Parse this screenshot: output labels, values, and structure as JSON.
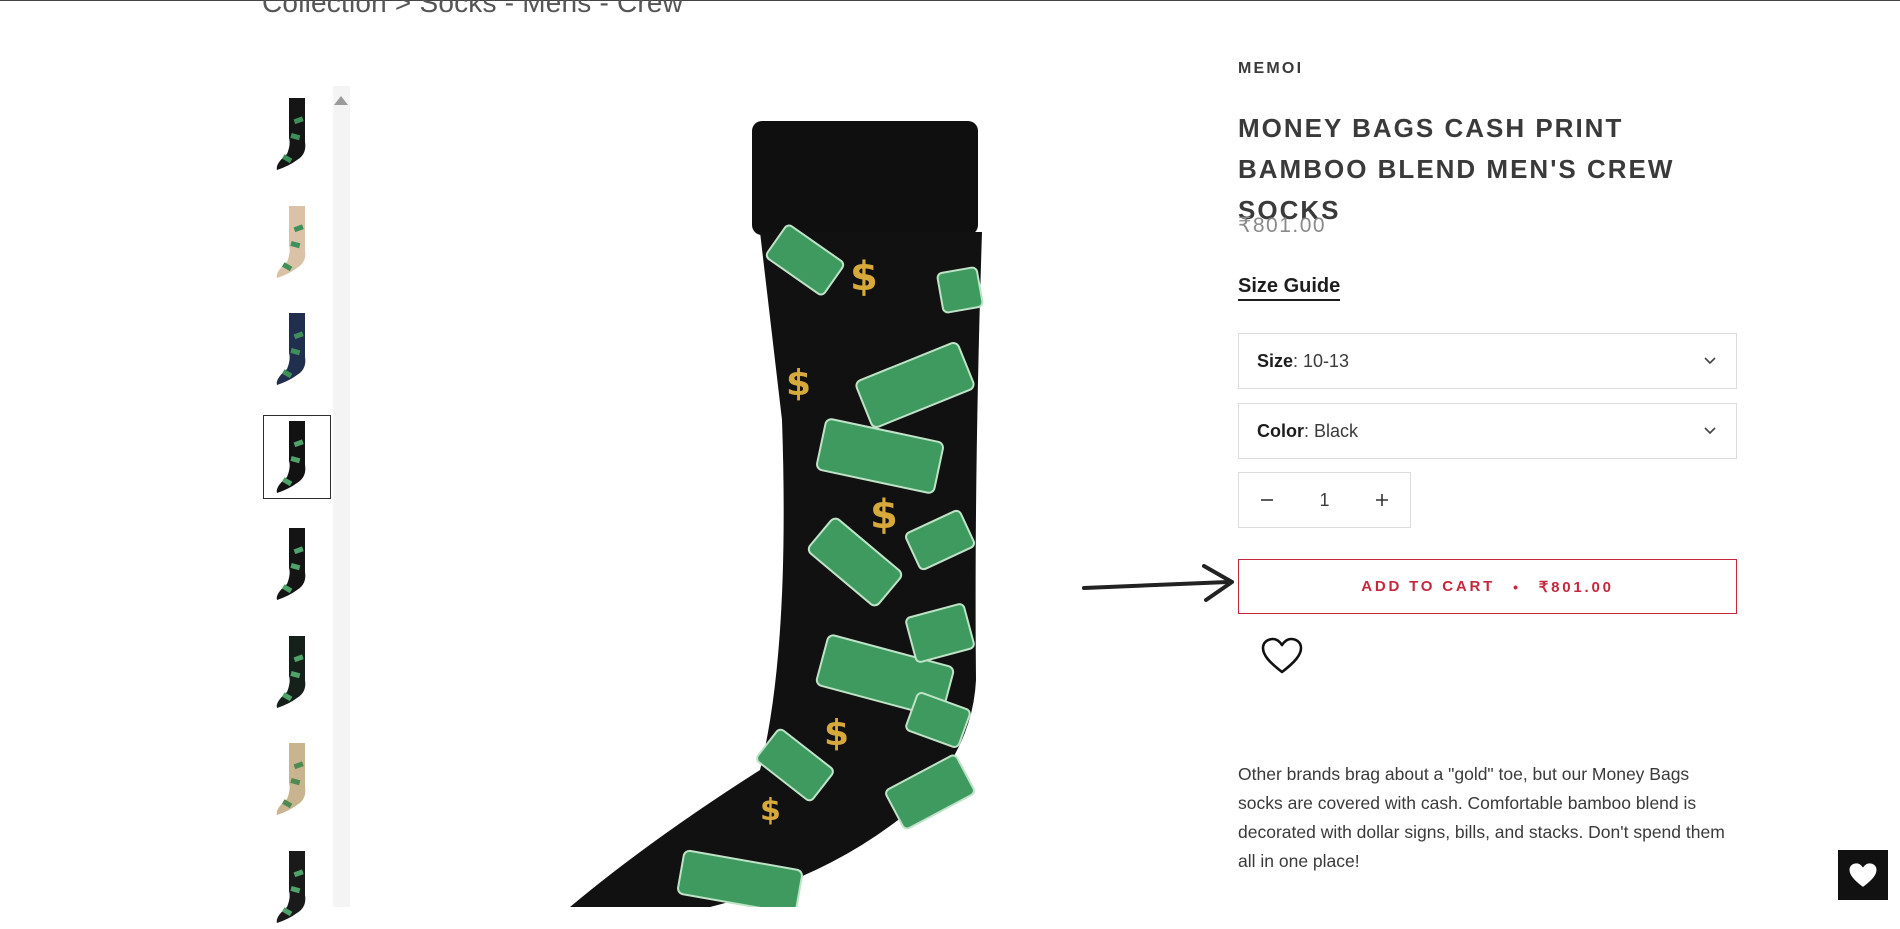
{
  "breadcrumb": "Collection > Socks - Mens - Crew",
  "product": {
    "vendor": "MEMOI",
    "title": "MONEY BAGS CASH PRINT BAMBOO BLEND MEN'S CREW SOCKS",
    "price": "₹801.00",
    "size_guide": "Size Guide",
    "size": {
      "label": "Size",
      "value": ": 10-13"
    },
    "color": {
      "label": "Color",
      "value": ": Black"
    },
    "quantity": "1",
    "add_to_cart": {
      "label": "ADD TO CART",
      "separator": "•",
      "price": "₹801.00"
    },
    "description": "Other brands brag about a \"gold\" toe, but our Money Bags socks are covered with cash. Comfortable bamboo blend is decorated with dollar signs, bills, and stacks. Don't spend them all in one place!"
  },
  "thumbnails": [
    {
      "name": "black-multicolor",
      "base": "#151515",
      "accent": "#3e8f5a",
      "active": false
    },
    {
      "name": "tan-cash",
      "base": "#d9c2a5",
      "accent": "#3e8f5a",
      "active": false
    },
    {
      "name": "navy-cash",
      "base": "#1f2f4d",
      "accent": "#3e8f5a",
      "active": false
    },
    {
      "name": "black-cash",
      "base": "#121212",
      "accent": "#4fa36a",
      "active": true
    },
    {
      "name": "black-pair",
      "base": "#141414",
      "accent": "#4fa36a",
      "active": false
    },
    {
      "name": "black-pair-2",
      "base": "#16201b",
      "accent": "#4fa36a",
      "active": false
    },
    {
      "name": "khaki-cash",
      "base": "#c8b48e",
      "accent": "#4f8a52",
      "active": false
    },
    {
      "name": "black-packaged",
      "base": "#1a1a1a",
      "accent": "#4fa36a",
      "active": false
    }
  ],
  "colors": {
    "accent": "#c5283d",
    "text": "#3a3a3a",
    "price": "#8a8a8a",
    "sock": "#0f0f0f",
    "bill": "#3e9a5e",
    "dollar": "#d6a93a"
  },
  "icons": {
    "wishlist": "heart-icon",
    "floating_wishlist": "heart-filled-icon",
    "select_caret": "chevron-down-icon",
    "qty_minus": "minus-icon",
    "qty_plus": "plus-icon",
    "scroll_up": "caret-up-icon",
    "pointer": "arrow-right-icon"
  }
}
